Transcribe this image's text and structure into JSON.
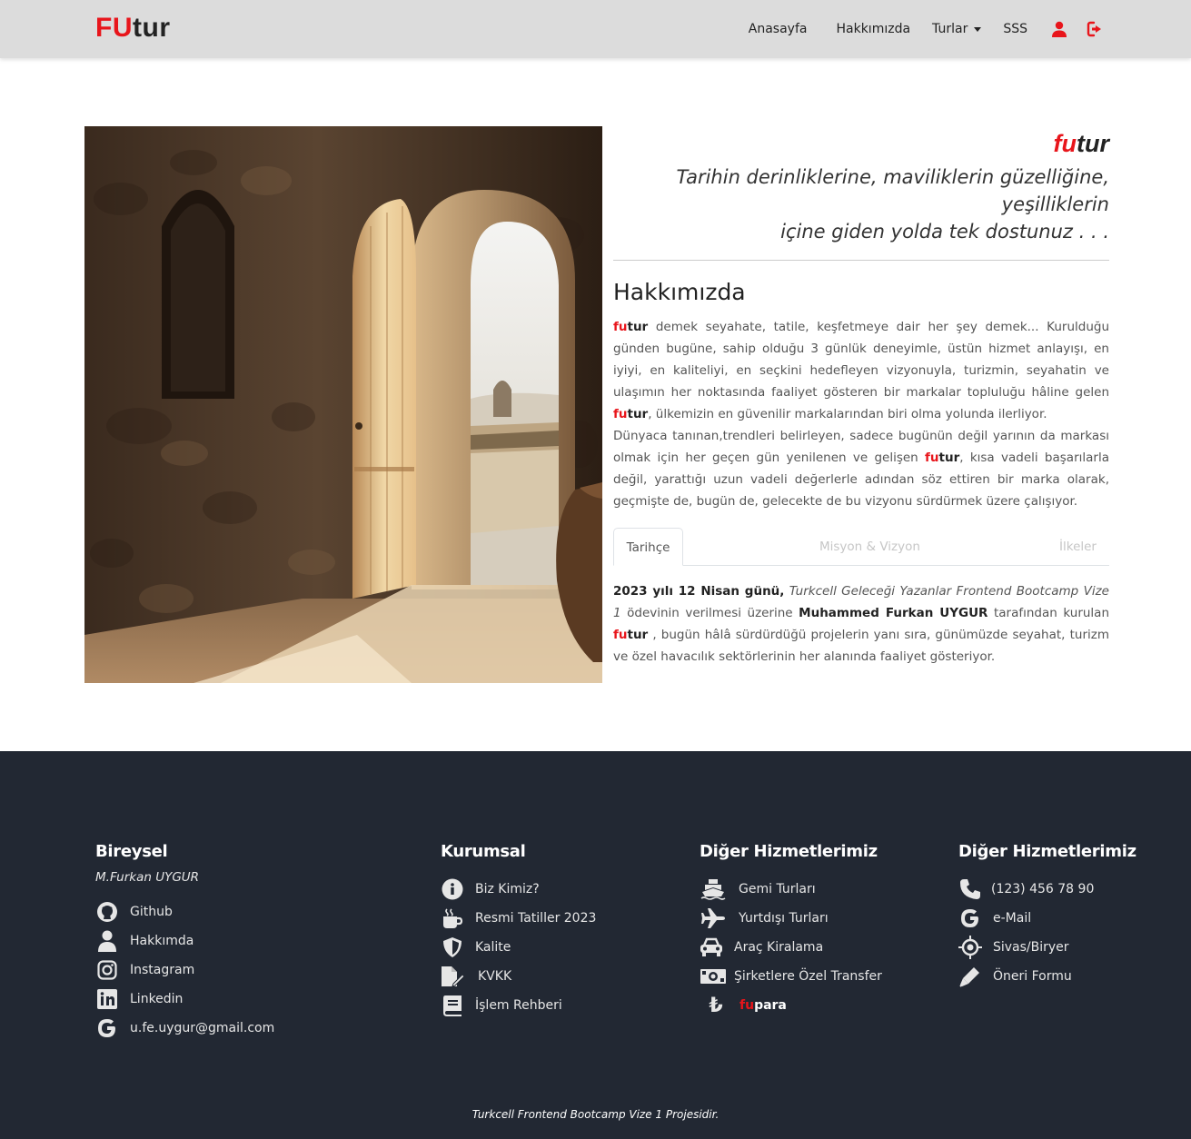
{
  "nav": {
    "brand_fu": "FU",
    "brand_tur": "tur",
    "links": [
      "Anasayfa",
      "Hakkımızda",
      "Turlar",
      "SSS"
    ]
  },
  "hero": {
    "image_alt": "Taş odada açık ahşap kapı"
  },
  "about": {
    "logo_fu": "fu",
    "logo_tur": "tur",
    "tagline_line1": "Tarihin derinliklerine, maviliklerin güzelliğine, yeşilliklerin",
    "tagline_line2": "içine giden yolda tek dostunuz . . .",
    "title": "Hakkımızda",
    "p1_a": " demek seyahate, tatile, keşfetmeye dair her şey demek... Kurulduğu günden bugüne, sahip olduğu 3 günlük deneyimle, üstün hizmet anlayışı, en iyiyi, en kaliteliyi, en seçkini hedefleyen vizyonuyla, turizmin, seyahatin ve ulaşımın her noktasında faaliyet gösteren bir markalar topluluğu hâline gelen ",
    "p1_b": ", ülkemizin en güvenilir markalarından biri olma yolunda ilerliyor.",
    "p2_a": "Dünyaca tanınan,trendleri belirleyen, sadece bugünün değil yarının da markası olmak için her geçen gün yenilenen ve gelişen ",
    "p2_b": ", kısa vadeli başarılarla değil, yarattığı uzun vadeli değerlerle adından söz ettiren bir marka olarak, geçmişte de, bugün de, gelecekte de bu vizyonu sürdürmek üzere çalışıyor."
  },
  "tabs": {
    "items": [
      "Tarihçe",
      "Misyon & Vizyon",
      "İlkeler"
    ],
    "history_date": "2023 yılı 12 Nisan günü,",
    "history_course": "Turkcell Geleceği Yazanlar Frontend Bootcamp Vize 1",
    "history_a": " ödevinin verilmesi üzerine ",
    "history_name": "Muhammed Furkan UYGUR",
    "history_b": " tarafından kurulan ",
    "history_c": " , bugün hâlâ sürdürdüğü projelerin yanı sıra, günümüzde seyahat, turizm ve özel havacılık sektörlerinin her alanında faaliyet gösteriyor."
  },
  "footer": {
    "col1": {
      "title": "Bireysel",
      "subtitle": "M.Furkan UYGUR",
      "items": [
        {
          "label": "Github",
          "icon": "github-icon"
        },
        {
          "label": "Hakkımda",
          "icon": "user-icon"
        },
        {
          "label": "Instagram",
          "icon": "instagram-icon"
        },
        {
          "label": "Linkedin",
          "icon": "linkedin-icon"
        },
        {
          "label": "u.fe.uygur@gmail.com",
          "icon": "google-icon"
        }
      ]
    },
    "col2": {
      "title": "Kurumsal",
      "items": [
        {
          "label": "Biz Kimiz?",
          "icon": "info-icon"
        },
        {
          "label": "Resmi Tatiller 2023",
          "icon": "coffee-icon"
        },
        {
          "label": "Kalite",
          "icon": "shield-icon"
        },
        {
          "label": "KVKK",
          "icon": "file-signature-icon"
        },
        {
          "label": "İşlem Rehberi",
          "icon": "book-icon"
        }
      ]
    },
    "col3": {
      "title": "Diğer Hizmetlerimiz",
      "items": [
        {
          "label": "Gemi Turları",
          "icon": "ship-icon"
        },
        {
          "label": "Yurtdışı Turları",
          "icon": "plane-icon"
        },
        {
          "label": "Araç Kiralama",
          "icon": "car-icon"
        },
        {
          "label": "Şirketlere Özel Transfer",
          "icon": "money-bill-icon"
        }
      ],
      "fupara_fu": "fu",
      "fupara_para": "para",
      "lira_glyph": "₺"
    },
    "col4": {
      "title": "Diğer Hizmetlerimiz",
      "items": [
        {
          "label": "(123) 456 78 90",
          "icon": "phone-icon"
        },
        {
          "label": "e-Mail",
          "icon": "google-icon"
        },
        {
          "label": "Sivas/Biryer",
          "icon": "location-crosshair-icon"
        },
        {
          "label": "Öneri Formu",
          "icon": "pen-icon"
        }
      ]
    },
    "copyright": "Turkcell Frontend Bootcamp Vize 1 Projesidir."
  }
}
